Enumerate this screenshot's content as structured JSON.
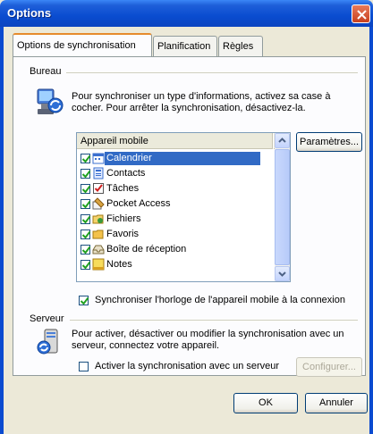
{
  "window": {
    "title": "Options"
  },
  "tabs": [
    {
      "label": "Options de synchronisation"
    },
    {
      "label": "Planification"
    },
    {
      "label": "Règles"
    }
  ],
  "bureau": {
    "title": "Bureau",
    "description_line1": "Pour synchroniser un type d'informations, activez sa case à",
    "description_line2": "cocher. Pour arrêter la synchronisation, désactivez-la.",
    "list_header": "Appareil mobile",
    "params_button": "Paramètres...",
    "items": [
      {
        "label": "Calendrier",
        "checked": true,
        "selected": true,
        "icon": "calendar-icon"
      },
      {
        "label": "Contacts",
        "checked": true,
        "icon": "contacts-icon"
      },
      {
        "label": "Tâches",
        "checked": true,
        "icon": "tasks-icon"
      },
      {
        "label": "Pocket Access",
        "checked": true,
        "icon": "pocket-access-icon"
      },
      {
        "label": "Fichiers",
        "checked": true,
        "icon": "files-icon"
      },
      {
        "label": "Favoris",
        "checked": true,
        "icon": "favorites-icon"
      },
      {
        "label": "Boîte de réception",
        "checked": true,
        "icon": "inbox-icon"
      },
      {
        "label": "Notes",
        "checked": true,
        "icon": "notes-icon"
      }
    ],
    "sync_clock_label": "Synchroniser l'horloge de l'appareil mobile à la connexion",
    "sync_clock_checked": true
  },
  "serveur": {
    "title": "Serveur",
    "description_line1": "Pour activer, désactiver ou modifier la synchronisation avec un",
    "description_line2": "serveur, connectez votre appareil.",
    "enable_label": "Activer la synchronisation avec un serveur",
    "enable_checked": false,
    "configure_button": "Configurer..."
  },
  "footer": {
    "ok_button": "OK",
    "cancel_button": "Annuler"
  },
  "colors": {
    "selection": "#316ac5",
    "titlebar": "#0a4cd0",
    "face": "#ece9d8"
  }
}
